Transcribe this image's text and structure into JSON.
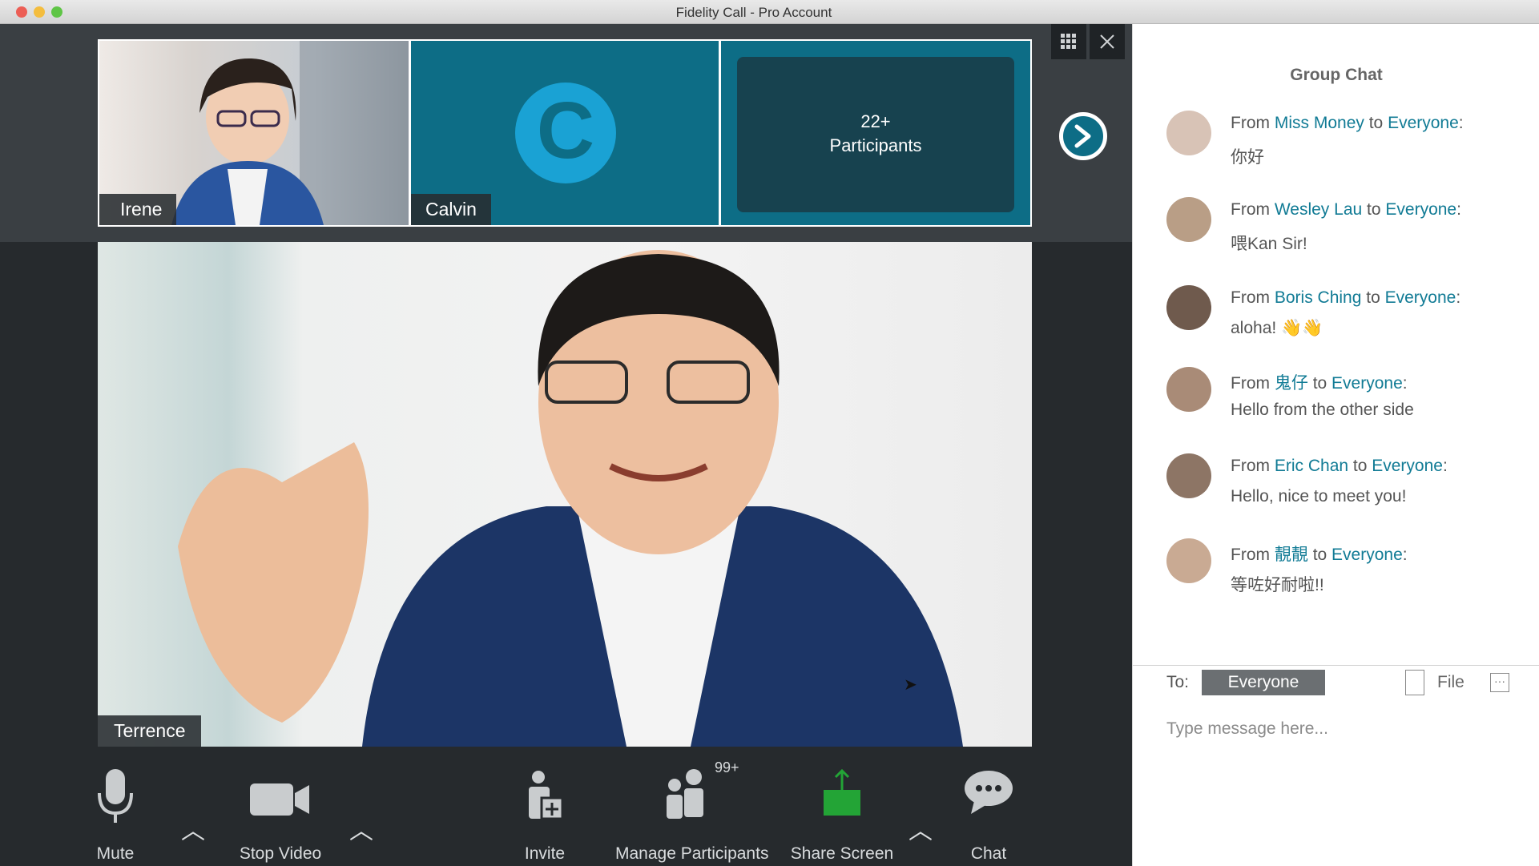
{
  "window": {
    "title": "Fidelity Call - Pro Account"
  },
  "thumbnails": [
    {
      "name": "Irene"
    },
    {
      "name": "Calvin",
      "initial": "C"
    },
    {
      "count": "22+",
      "label": "Participants"
    }
  ],
  "main_video": {
    "name": "Terrence"
  },
  "controls": {
    "mute": "Mute",
    "stop_video": "Stop Video",
    "invite": "Invite",
    "manage_participants": "Manage Participants",
    "participants_badge": "99+",
    "share_screen": "Share Screen",
    "chat": "Chat"
  },
  "chat": {
    "title": "Group Chat",
    "from_word": "From",
    "to_word": "to",
    "messages": [
      {
        "sender": "Miss Money",
        "recipient": "Everyone",
        "text": "你好"
      },
      {
        "sender": "Wesley Lau",
        "recipient": "Everyone",
        "text": "喂Kan Sir!"
      },
      {
        "sender": "Boris Ching",
        "recipient": "Everyone",
        "text": "aloha! 👋👋"
      },
      {
        "sender": "鬼仔",
        "recipient": "Everyone",
        "text": "Hello from the other side"
      },
      {
        "sender": "Eric Chan",
        "recipient": "Everyone",
        "text": "Hello, nice to meet you!"
      },
      {
        "sender": "靚靚",
        "recipient": "Everyone",
        "text": "等咗好耐啦!!"
      }
    ],
    "to_label": "To:",
    "to_value": "Everyone",
    "file_label": "File",
    "more_label": "···",
    "input_placeholder": "Type message here..."
  },
  "colors": {
    "accent": "#0d6d86",
    "link": "#117b95",
    "dark_bg": "#262a2d"
  }
}
